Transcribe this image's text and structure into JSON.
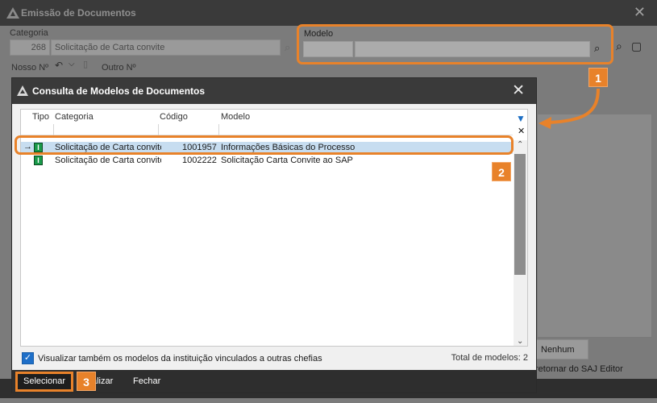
{
  "outer": {
    "title": "Emissão de Documentos",
    "categoria_label": "Categoria",
    "categoria_code": "268",
    "categoria_value": "Solicitação de Carta convite",
    "modelo_label": "Modelo",
    "nosso_label": "Nosso Nº",
    "outro_label": "Outro Nº",
    "nenhum_button": "Nenhum",
    "retornar_text": "retornar do SAJ Editor"
  },
  "annotations": {
    "badge1": "1",
    "badge2": "2",
    "badge3": "3",
    "accent_color": "#e8822a"
  },
  "dialog": {
    "title": "Consulta de Modelos de Documentos",
    "columns": {
      "tipo": "Tipo",
      "categoria": "Categoria",
      "codigo": "Código",
      "modelo": "Modelo"
    },
    "rows": [
      {
        "tipo": "I",
        "categoria": "Solicitação de Carta convite",
        "codigo": "1001957",
        "modelo": "Informações Básicas do Processo",
        "selected": true
      },
      {
        "tipo": "I",
        "categoria": "Solicitação de Carta convite",
        "codigo": "1002222",
        "modelo": "Solicitação Carta Convite ao SAP",
        "selected": false
      }
    ],
    "checkbox_label": "Visualizar também os modelos da instituição vinculados a outras chefias",
    "total_label": "Total de modelos: 2",
    "buttons": {
      "selecionar": "Selecionar",
      "visualizar": "alizar",
      "fechar": "Fechar"
    }
  }
}
